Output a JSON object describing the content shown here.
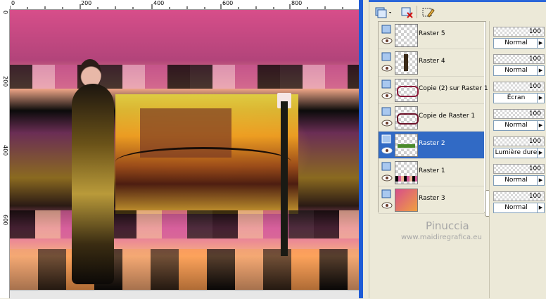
{
  "ruler": {
    "top_labels": [
      "0",
      "200",
      "400",
      "600",
      "800"
    ],
    "left_labels": [
      "0",
      "200",
      "400",
      "600"
    ]
  },
  "layers_palette": {
    "toolbar": {
      "new_layer_icon": "new-raster-layer-icon",
      "delete_icon": "delete-layer-icon",
      "edit_icon": "edit-selection-icon"
    },
    "layers": [
      {
        "name": "Raster 5",
        "opacity": "100",
        "blend": "Normal",
        "selected": false
      },
      {
        "name": "Raster 4",
        "opacity": "100",
        "blend": "Normal",
        "selected": false
      },
      {
        "name": "Copie (2) sur Raster 1",
        "opacity": "100",
        "blend": "Écran",
        "selected": false
      },
      {
        "name": "Copie de Raster 1",
        "opacity": "100",
        "blend": "Normal",
        "selected": false
      },
      {
        "name": "Raster 2",
        "opacity": "100",
        "blend": "Lumière dure",
        "selected": true
      },
      {
        "name": "Raster 1",
        "opacity": "100",
        "blend": "Normal",
        "selected": false
      },
      {
        "name": "Raster 3",
        "opacity": "100",
        "blend": "Normal",
        "selected": false
      }
    ]
  },
  "watermark": {
    "name": "Pinuccia",
    "url": "www.maidiregrafica.eu"
  },
  "colors": {
    "selection": "#316ac5",
    "frame_blue": "#1e5bd6"
  }
}
